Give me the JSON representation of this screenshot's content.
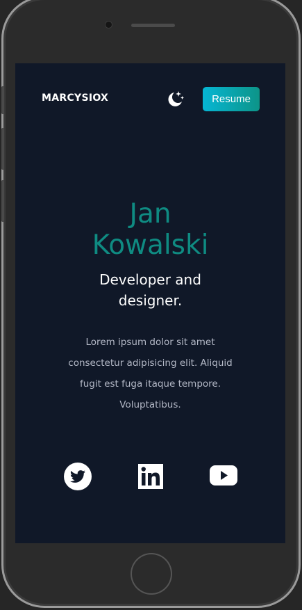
{
  "header": {
    "logo": "MARCYSIOX",
    "theme_toggle_icon": "moon-stars-icon",
    "resume_label": "Resume"
  },
  "hero": {
    "name_first": "Jan",
    "name_last": "Kowalski",
    "role_line1": "Developer and",
    "role_line2": "designer.",
    "bio_line1": "Lorem ipsum dolor sit amet",
    "bio_line2": "consectetur adipisicing elit. Aliquid",
    "bio_line3": "fugit est fuga itaque tempore.",
    "bio_line4": "Voluptatibus."
  },
  "social": [
    {
      "icon": "twitter-icon"
    },
    {
      "icon": "linkedin-icon"
    },
    {
      "icon": "youtube-icon"
    }
  ],
  "colors": {
    "background": "#101828",
    "accent": "#0f8b82",
    "button_gradient_start": "#06b6d4",
    "button_gradient_end": "#0d9488",
    "text_primary": "#ffffff",
    "text_muted": "#b3b8c6"
  }
}
